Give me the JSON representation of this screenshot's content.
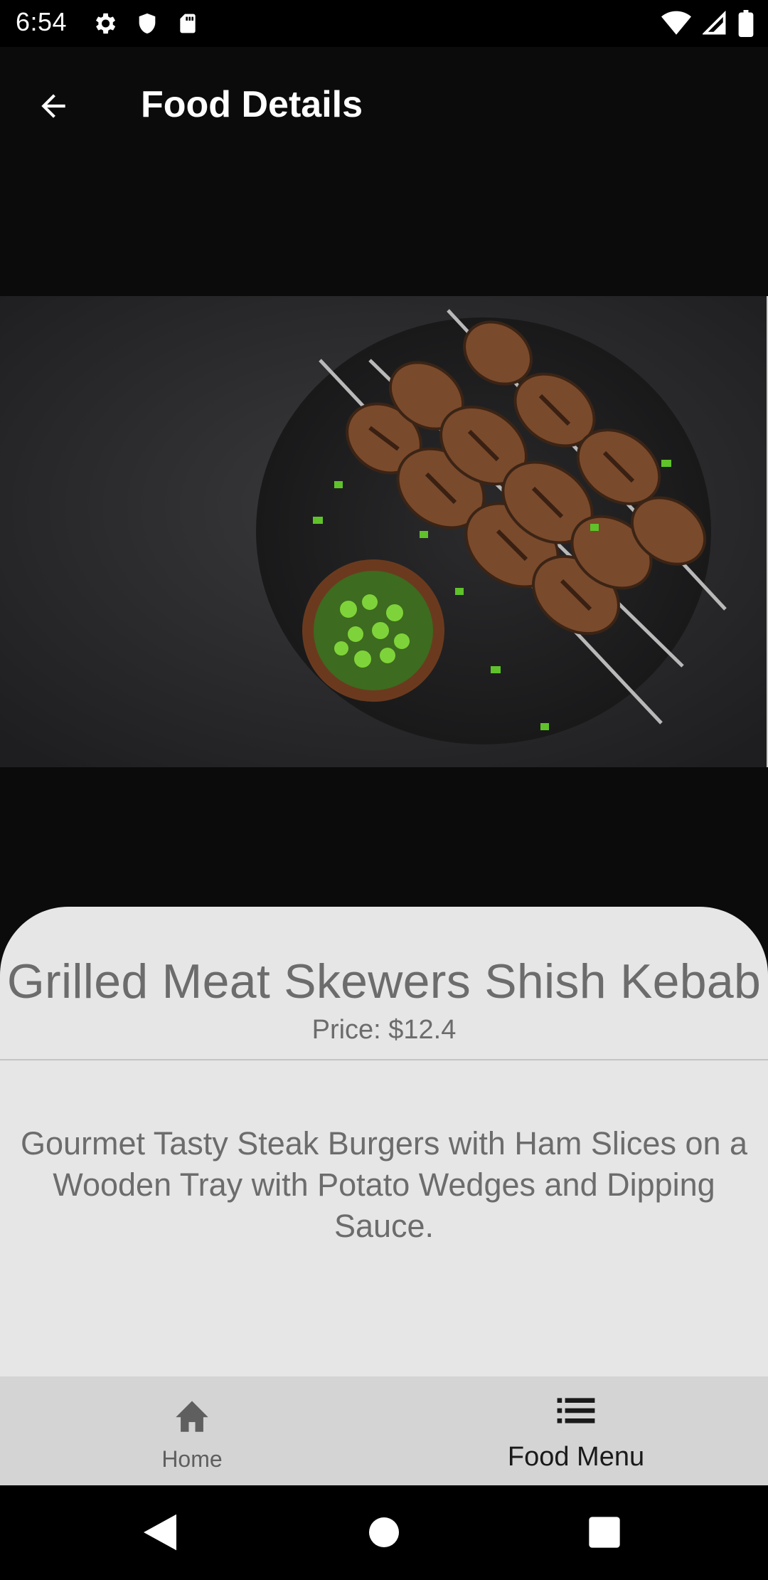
{
  "status_bar": {
    "time": "6:54",
    "icons_left": [
      "settings-gear-icon",
      "shield-icon",
      "sd-card-icon"
    ],
    "icons_right": [
      "wifi-icon",
      "cellular-signal-icon",
      "battery-icon"
    ]
  },
  "app_bar": {
    "back_icon": "arrow-left-icon",
    "title": "Food Details"
  },
  "hero": {
    "image_subject": "grilled-meat-skewers-photo"
  },
  "details": {
    "name": "Grilled Meat Skewers Shish Kebab",
    "price": "Price: $12.4",
    "description": "Gourmet Tasty Steak Burgers with Ham Slices on a Wooden Tray with Potato Wedges and Dipping Sauce."
  },
  "bottom_nav": {
    "items": [
      {
        "label": "Home",
        "icon": "home-icon",
        "selected": false
      },
      {
        "label": "Food Menu",
        "icon": "list-icon",
        "selected": true
      }
    ]
  },
  "system_nav": {
    "buttons": [
      "back-triangle-icon",
      "home-circle-icon",
      "recents-square-icon"
    ]
  },
  "colors": {
    "background": "#0b0b0c",
    "card": "#e6e6e6",
    "bottom_nav": "#d4d4d4",
    "text_muted": "#6c6c6c"
  }
}
